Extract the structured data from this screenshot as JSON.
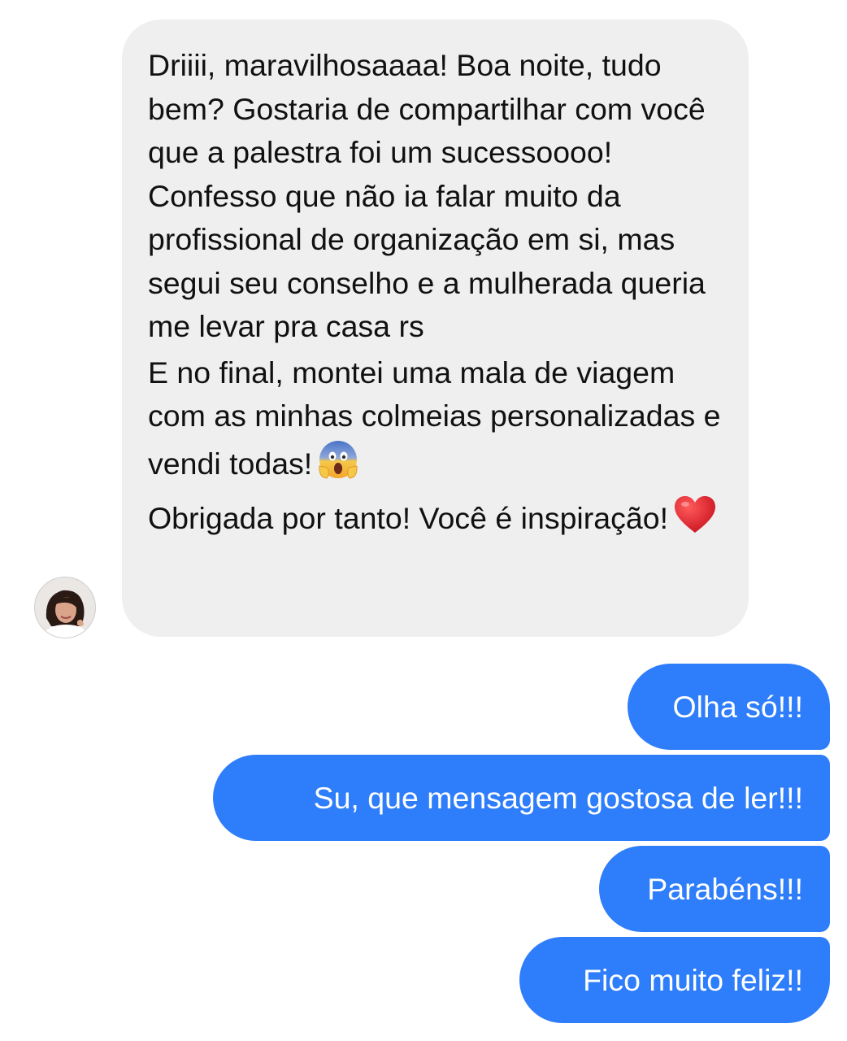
{
  "incoming_message": {
    "paragraphs": [
      "Driiii, maravilhosaaaa! Boa noite, tudo bem? Gostaria de compartilhar com você que a palestra foi um sucessoooo! Confesso que não ia falar muito da profissional de organização em si, mas segui seu conselho e a mulherada queria me levar pra casa rs",
      "E no final, montei uma mala de viagem com as minhas colmeias personalizadas e vendi todas!",
      "Obrigada por tanto! Você é inspiração!"
    ],
    "emojis": [
      "face-screaming-in-fear-icon",
      "red-heart-icon"
    ]
  },
  "outgoing_messages": [
    "Olha só!!!",
    "Su, que mensagem gostosa de ler!!!",
    "Parabéns!!!",
    "Fico muito feliz!!"
  ],
  "colors": {
    "incoming_bubble": "#efefef",
    "outgoing_bubble": "#2e7dfa",
    "incoming_text": "#111111",
    "outgoing_text": "#ffffff"
  }
}
